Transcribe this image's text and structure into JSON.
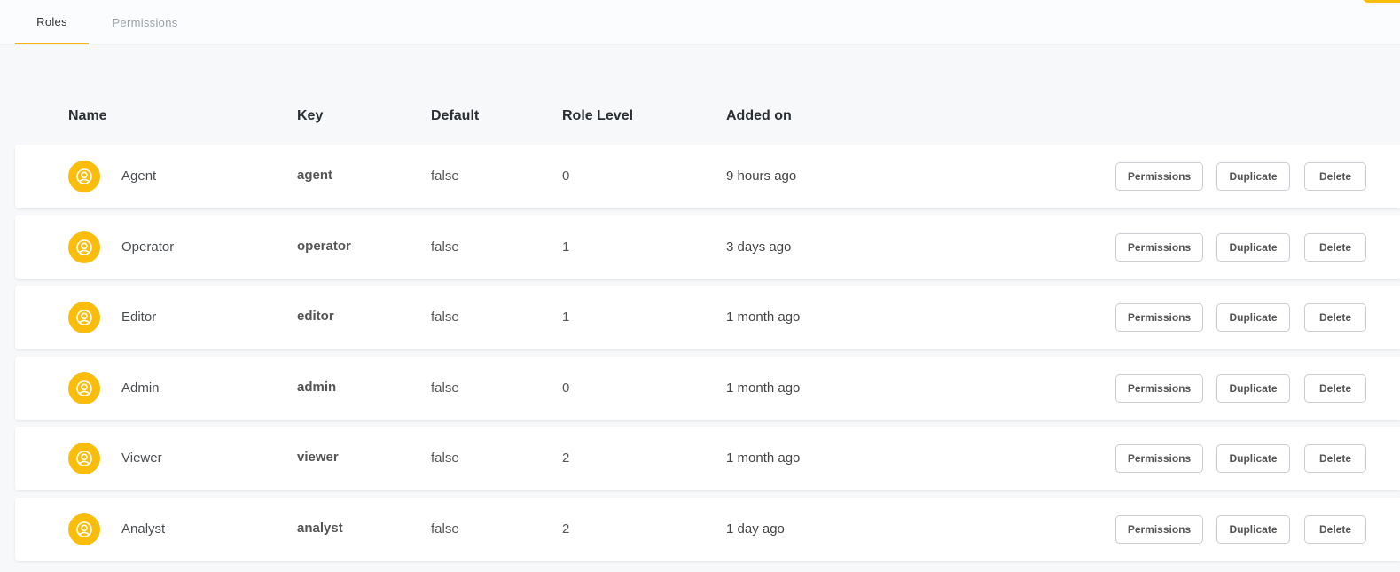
{
  "tabs": [
    {
      "label": "Roles",
      "active": true
    },
    {
      "label": "Permissions",
      "active": false
    }
  ],
  "columns": {
    "name": "Name",
    "key": "Key",
    "default": "Default",
    "level": "Role Level",
    "added": "Added on"
  },
  "actions": {
    "permissions": "Permissions",
    "duplicate": "Duplicate",
    "delete": "Delete"
  },
  "rows": [
    {
      "name": "Agent",
      "key": "agent",
      "default": "false",
      "level": "0",
      "added": "9 hours ago"
    },
    {
      "name": "Operator",
      "key": "operator",
      "default": "false",
      "level": "1",
      "added": "3 days ago"
    },
    {
      "name": "Editor",
      "key": "editor",
      "default": "false",
      "level": "1",
      "added": "1 month ago"
    },
    {
      "name": "Admin",
      "key": "admin",
      "default": "false",
      "level": "0",
      "added": "1 month ago"
    },
    {
      "name": "Viewer",
      "key": "viewer",
      "default": "false",
      "level": "2",
      "added": "1 month ago"
    },
    {
      "name": "Analyst",
      "key": "analyst",
      "default": "false",
      "level": "2",
      "added": "1 day ago"
    }
  ],
  "colors": {
    "accent": "#fbbd0c",
    "tab_underline": "#f5b50a",
    "background": "#f7f8f9"
  },
  "icons": {
    "avatar": "user-circle-icon"
  }
}
